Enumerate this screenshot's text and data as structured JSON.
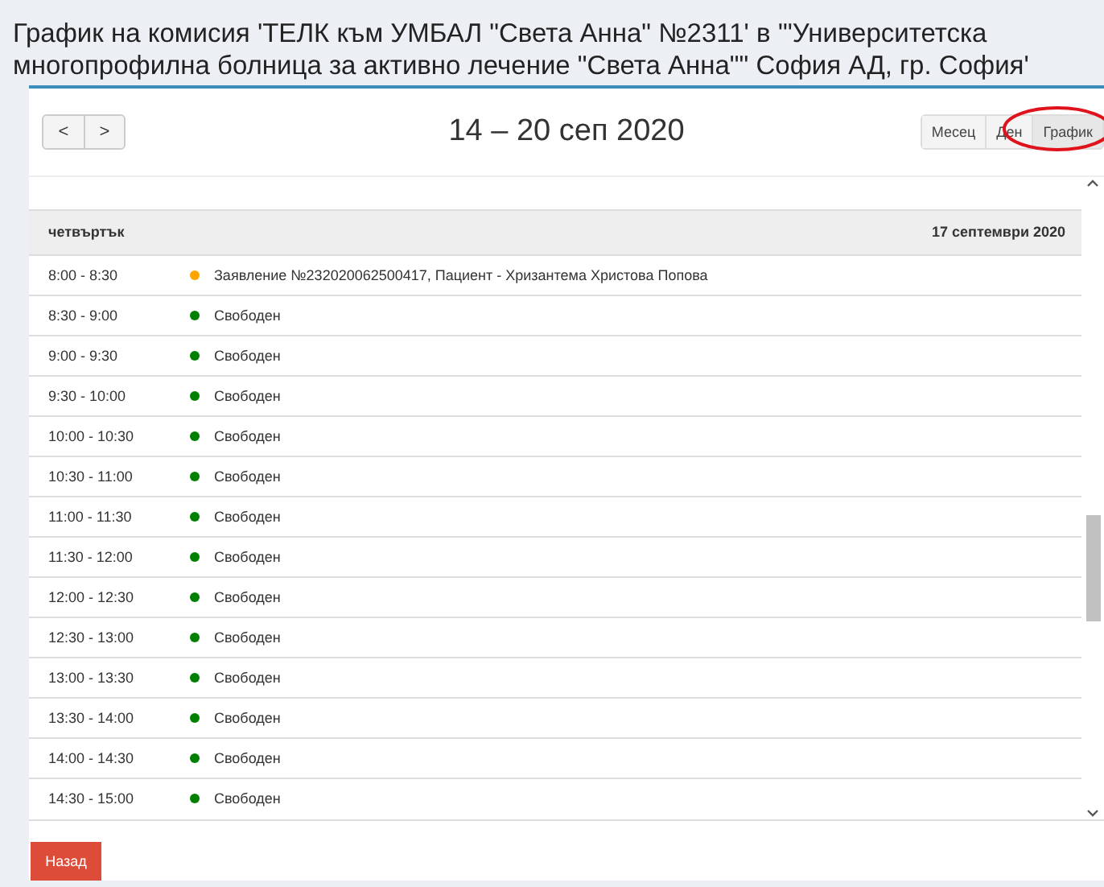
{
  "title": "График на комисия 'ТЕЛК към УМБАЛ \"Света Анна\" №2311' в '\"Университетска многопрофилна болница за активно лечение \"Света Анна\"\" София АД, гр. София'",
  "nav": {
    "prev": "<",
    "next": ">"
  },
  "range": "14 – 20 сеп 2020",
  "views": [
    {
      "label": "Месец",
      "selected": false
    },
    {
      "label": "Ден",
      "selected": false
    },
    {
      "label": "График",
      "selected": true
    }
  ],
  "day": {
    "name": "четвъртък",
    "date": "17 септември 2020"
  },
  "slots": [
    {
      "time": "8:00 - 8:30",
      "text": "Заявление №232020062500417, Пациент - Хризантема Христова Попова",
      "color": "#ffa500"
    },
    {
      "time": "8:30 - 9:00",
      "text": "Свободен",
      "color": "#008000"
    },
    {
      "time": "9:00 - 9:30",
      "text": "Свободен",
      "color": "#008000"
    },
    {
      "time": "9:30 - 10:00",
      "text": "Свободен",
      "color": "#008000"
    },
    {
      "time": "10:00 - 10:30",
      "text": "Свободен",
      "color": "#008000"
    },
    {
      "time": "10:30 - 11:00",
      "text": "Свободен",
      "color": "#008000"
    },
    {
      "time": "11:00 - 11:30",
      "text": "Свободен",
      "color": "#008000"
    },
    {
      "time": "11:30 - 12:00",
      "text": "Свободен",
      "color": "#008000"
    },
    {
      "time": "12:00 - 12:30",
      "text": "Свободен",
      "color": "#008000"
    },
    {
      "time": "12:30 - 13:00",
      "text": "Свободен",
      "color": "#008000"
    },
    {
      "time": "13:00 - 13:30",
      "text": "Свободен",
      "color": "#008000"
    },
    {
      "time": "13:30 - 14:00",
      "text": "Свободен",
      "color": "#008000"
    },
    {
      "time": "14:00 - 14:30",
      "text": "Свободен",
      "color": "#008000"
    },
    {
      "time": "14:30 - 15:00",
      "text": "Свободен",
      "color": "#008000"
    }
  ],
  "back_button": "Назад"
}
